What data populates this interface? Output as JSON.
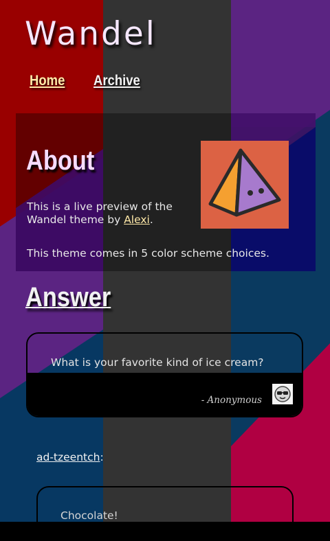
{
  "site": {
    "title": "Wandel"
  },
  "nav": [
    {
      "label": "Home"
    },
    {
      "label": "Archive"
    }
  ],
  "about": {
    "title": "About",
    "text_prefix": "This is a live preview of the Wandel theme by ",
    "author_link": "Alexi",
    "text_suffix": ".",
    "text2": "This theme comes in 5 color scheme choices."
  },
  "answer": {
    "title": "Answer",
    "question": "What is your favorite kind of ice cream?",
    "asker": "- Anonymous",
    "answerer": "ad-tzeentch",
    "answerer_suffix": ":",
    "reply": "Chocolate!"
  },
  "colors": {
    "red": "#990000",
    "gray": "#333333",
    "purple": "#5b2482",
    "blue": "#0a3a60",
    "crimson": "#b00042",
    "avatar_bg": "#dc6244",
    "link_yellow": "#ffe9a8"
  },
  "icons": {
    "about_avatar": "pyramid-face-icon",
    "asker_avatar": "sunglasses-face-icon"
  }
}
